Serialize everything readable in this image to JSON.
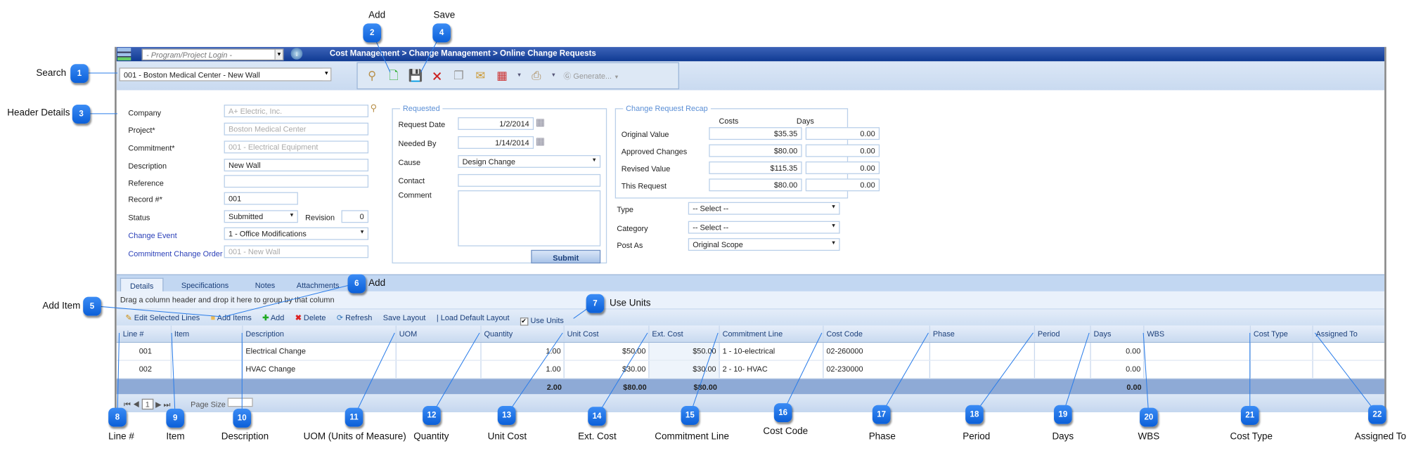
{
  "app": {
    "title": "Cost Management > Change Management > Online Change Requests",
    "login_placeholder": "- Program/Project Login -",
    "project_select": "001 - Boston Medical Center - New Wall"
  },
  "toolbar": {
    "generate_label": "Generate..."
  },
  "header": {
    "labels": {
      "company": "Company",
      "project": "Project*",
      "commitment": "Commitment*",
      "description": "Description",
      "reference": "Reference",
      "record": "Record #*",
      "status": "Status",
      "revision": "Revision",
      "change_event": "Change Event",
      "commitment_change_order": "Commitment Change Order"
    },
    "values": {
      "company": "A+ Electric, Inc.",
      "project": "Boston Medical Center",
      "commitment": "001 - Electrical Equipment",
      "description": "New Wall",
      "reference": "",
      "record": "001",
      "status": "Submitted",
      "revision": "0",
      "change_event": "1 - Office Modifications",
      "commitment_change_order": "001 - New Wall"
    }
  },
  "requested": {
    "legend": "Requested",
    "request_date_label": "Request Date",
    "request_date": "1/2/2014",
    "needed_by_label": "Needed By",
    "needed_by": "1/14/2014",
    "cause_label": "Cause",
    "cause": "Design Change",
    "contact_label": "Contact",
    "contact": "",
    "comment_label": "Comment",
    "comment": "",
    "submit": "Submit"
  },
  "recap": {
    "legend": "Change Request Recap",
    "costs_header": "Costs",
    "days_header": "Days",
    "rows": [
      {
        "label": "Original Value",
        "cost": "$35.35",
        "days": "0.00"
      },
      {
        "label": "Approved Changes",
        "cost": "$80.00",
        "days": "0.00"
      },
      {
        "label": "Revised Value",
        "cost": "$115.35",
        "days": "0.00"
      },
      {
        "label": "This Request",
        "cost": "$80.00",
        "days": "0.00"
      }
    ],
    "type_label": "Type",
    "type": "-- Select --",
    "category_label": "Category",
    "category": "-- Select --",
    "post_as_label": "Post As",
    "post_as": "Original Scope"
  },
  "tabs": [
    "Details",
    "Specifications",
    "Notes",
    "Attachments"
  ],
  "grid": {
    "group_hint": "Drag a column header and drop it here to group by that column",
    "toolbar": {
      "edit": "Edit Selected Lines",
      "add_items": "Add Items",
      "add": "Add",
      "delete": "Delete",
      "refresh": "Refresh",
      "save_layout": "Save Layout",
      "load_default": "| Load Default Layout",
      "use_units": "Use Units",
      "use_units_checked": true
    },
    "columns": [
      "Line #",
      "Item",
      "Description",
      "UOM",
      "Quantity",
      "Unit Cost",
      "Ext. Cost",
      "Commitment Line",
      "Cost Code",
      "Phase",
      "Period",
      "Days",
      "WBS",
      "Cost Type",
      "Assigned To"
    ],
    "rows": [
      [
        "001",
        "",
        "Electrical Change",
        "",
        "1.00",
        "$50.00",
        "$50.00",
        "1 - 10-electrical",
        "02-260000",
        "",
        "",
        "0.00",
        "",
        "",
        ""
      ],
      [
        "002",
        "",
        "HVAC Change",
        "",
        "1.00",
        "$30.00",
        "$30.00",
        "2 - 10- HVAC",
        "02-230000",
        "",
        "",
        "0.00",
        "",
        "",
        ""
      ]
    ],
    "footer": {
      "quantity": "2.00",
      "unit_cost": "$80.00",
      "ext_cost": "$80.00",
      "days": "0.00"
    },
    "pager": {
      "page": "1",
      "page_size_label": "Page Size"
    }
  },
  "callouts": [
    {
      "n": "1",
      "label": "Search"
    },
    {
      "n": "2",
      "label": "Add"
    },
    {
      "n": "3",
      "label": "Header Details"
    },
    {
      "n": "4",
      "label": "Save"
    },
    {
      "n": "5",
      "label": "Add Item"
    },
    {
      "n": "6",
      "label": "Add"
    },
    {
      "n": "7",
      "label": "Use Units"
    },
    {
      "n": "8",
      "label": "Line #"
    },
    {
      "n": "9",
      "label": "Item"
    },
    {
      "n": "10",
      "label": "Description"
    },
    {
      "n": "11",
      "label": "UOM (Units of Measure)"
    },
    {
      "n": "12",
      "label": "Quantity"
    },
    {
      "n": "13",
      "label": "Unit Cost"
    },
    {
      "n": "14",
      "label": "Ext. Cost"
    },
    {
      "n": "15",
      "label": "Commitment Line"
    },
    {
      "n": "16",
      "label": "Cost Code"
    },
    {
      "n": "17",
      "label": "Phase"
    },
    {
      "n": "18",
      "label": "Period"
    },
    {
      "n": "19",
      "label": "Days"
    },
    {
      "n": "20",
      "label": "WBS"
    },
    {
      "n": "21",
      "label": "Cost Type"
    },
    {
      "n": "22",
      "label": "Assigned To"
    }
  ]
}
